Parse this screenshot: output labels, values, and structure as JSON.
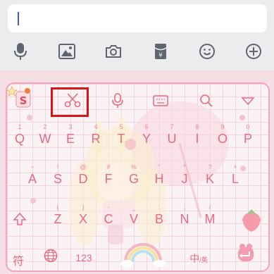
{
  "input": {
    "value": ""
  },
  "toolbar": {
    "icons": [
      "microphone-icon",
      "image-icon",
      "camera-icon",
      "red-packet-icon",
      "emoji-icon",
      "add-icon"
    ]
  },
  "keyboard": {
    "logo_letter": "S",
    "top_tools": [
      "scissors-icon",
      "voice-icon",
      "keyboard-icon",
      "search-icon",
      "collapse-icon"
    ],
    "row1": [
      {
        "main": "Q",
        "sub": "1"
      },
      {
        "main": "W",
        "sub": "2"
      },
      {
        "main": "E",
        "sub": "3"
      },
      {
        "main": "R",
        "sub": "4"
      },
      {
        "main": "T",
        "sub": "5"
      },
      {
        "main": "Y",
        "sub": "6"
      },
      {
        "main": "U",
        "sub": "7"
      },
      {
        "main": "I",
        "sub": "8"
      },
      {
        "main": "O",
        "sub": "9"
      },
      {
        "main": "P",
        "sub": "0"
      }
    ],
    "row2": [
      {
        "main": "A",
        "sub": "~"
      },
      {
        "main": "S",
        "sub": "!"
      },
      {
        "main": "D",
        "sub": "@"
      },
      {
        "main": "F",
        "sub": "#"
      },
      {
        "main": "G",
        "sub": "%"
      },
      {
        "main": "H",
        "sub": "\""
      },
      {
        "main": "J",
        "sub": "*"
      },
      {
        "main": "K",
        "sub": "?"
      },
      {
        "main": "L",
        "sub": "+"
      }
    ],
    "row3": [
      {
        "main": "Z",
        "sub": "("
      },
      {
        "main": "X",
        "sub": ")"
      },
      {
        "main": "C",
        "sub": "-"
      },
      {
        "main": "V",
        "sub": "_"
      },
      {
        "main": "B",
        "sub": ":"
      },
      {
        "main": "N",
        "sub": ";"
      },
      {
        "main": "M",
        "sub": "/"
      }
    ],
    "bottom": {
      "symbol": "符",
      "number": "123",
      "lang_main": "中",
      "lang_sub": "/英"
    },
    "colors": {
      "key_text": "#e46a86",
      "border": "#f1a7b8",
      "highlight": "#d8141b"
    }
  }
}
